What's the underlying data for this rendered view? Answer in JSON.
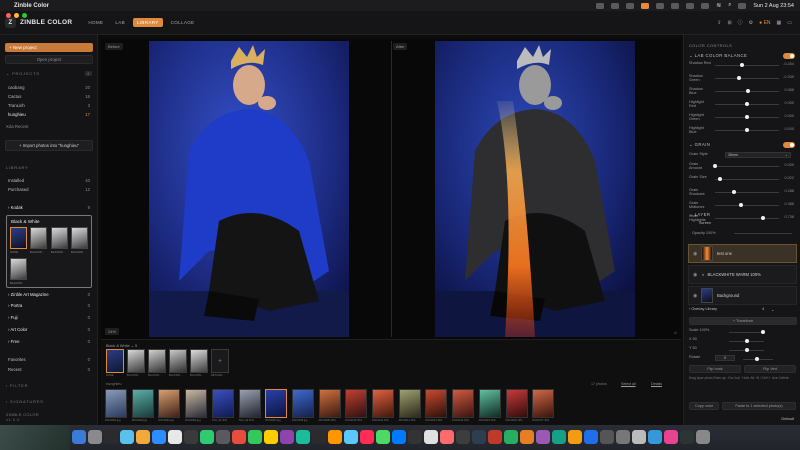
{
  "menubar": {
    "app_name": "Zinble Color",
    "datetime": "Sun 2 Aug  23:54"
  },
  "app": {
    "logo_letter": "Z",
    "title": "ZINBLE COLOR",
    "nav_tabs": [
      {
        "label": "HOME",
        "active": false
      },
      {
        "label": "LAB",
        "active": false
      },
      {
        "label": "LIBRARY",
        "active": true
      },
      {
        "label": "COLLAGE",
        "active": false
      }
    ],
    "user_label": "EN"
  },
  "left_sidebar": {
    "new_project_label": "+ New project",
    "open_project_label": "Open project",
    "projects_header": "PROJECTS",
    "projects_count": "4",
    "projects": [
      {
        "name": "caobang",
        "count": "20"
      },
      {
        "name": "Cactus",
        "count": "16"
      },
      {
        "name": "TranLinh",
        "count": "3"
      },
      {
        "name": "hunghieu",
        "count": "17"
      }
    ],
    "recent_label": "Xóa Recent",
    "import_label": "+ Import photos into \"hunghieu\"",
    "library_header": "LIBRARY",
    "library_items": [
      {
        "name": "Installed",
        "count": "40"
      },
      {
        "name": "Purchased",
        "count": "12"
      }
    ],
    "kodak": {
      "name": "Kodak",
      "count": "9"
    },
    "bw_group": {
      "name": "Black & White",
      "thumbs": [
        "NONE",
        "BLACKW...",
        "BLACKW...",
        "BLACKW...",
        "BLACKW..."
      ]
    },
    "collections": [
      {
        "name": "Zinble Art Magazine",
        "count": "0"
      },
      {
        "name": "Portra",
        "count": "0"
      },
      {
        "name": "Fuji",
        "count": "0"
      },
      {
        "name": "Art Color",
        "count": "0"
      },
      {
        "name": "Free",
        "count": "0"
      }
    ],
    "footer_items": [
      {
        "name": "Favorites",
        "count": "0"
      },
      {
        "name": "Recent",
        "count": "0"
      }
    ],
    "filter_header": "FILTER",
    "signature_header": "SIGNATURES",
    "brand": "ZINBLE COLOR",
    "version": "v1.0.0"
  },
  "canvas": {
    "before_label": "Before",
    "after_label": "After",
    "zoom": "24%"
  },
  "bottom": {
    "preset_group_label": "Black & White",
    "preset_count": "5",
    "preset_thumbs": [
      "NONE",
      "BLACKW...",
      "BLACKW...",
      "BLACKW...",
      "BLACKW...",
      "RETHINK..."
    ],
    "filmstrip_label": "hunghieu",
    "filmstrip_info": "17 photos",
    "select_all": "Select all",
    "details_label": "Details",
    "film_captions": [
      "DSC0001.jpg",
      "DSC0002.jpg",
      "DSC0003.jpg",
      "DSC0004.jpg",
      "THU_01.JPG",
      "THU_02.JPG",
      "DSC0007.jpg",
      "DSC0008.jpg",
      "DSC0009.JPG",
      "DSC0010.JPG",
      "DSC0011.JPG",
      "DSC0012.JPG",
      "DSC0013.JPG",
      "DSC0014.JPG",
      "DSC0015.JPG",
      "DSC0016.JPG",
      "DSC0017.JPG"
    ]
  },
  "right_panel": {
    "color_controls_header": "COLOR CONTROLS",
    "lab_balance_header": "LAB COLOR BALANCE",
    "lab_sliders": [
      {
        "label": "Shadow Red",
        "value": "-0.254",
        "pos": 0.42
      },
      {
        "label": "Shadow Green",
        "value": "-0.335",
        "pos": 0.38
      },
      {
        "label": "Shadow Blue",
        "value": "0.066",
        "pos": 0.52
      },
      {
        "label": "Highlight Red",
        "value": "0.000",
        "pos": 0.5
      },
      {
        "label": "Highlight Green",
        "value": "0.000",
        "pos": 0.5
      },
      {
        "label": "Highlight Blue",
        "value": "0.000",
        "pos": 0.5
      }
    ],
    "grain_header": "GRAIN",
    "grain_style_label": "Grain Style",
    "grain_style_value": "35mm",
    "grain_sliders": [
      {
        "label": "Grain Amount",
        "value": "0.000",
        "pos": 0.0
      },
      {
        "label": "Grain Size",
        "value": "0.022",
        "pos": 0.08
      },
      {
        "label": "Grain Shadows",
        "value": "0.288",
        "pos": 0.3
      },
      {
        "label": "Grain Midtones",
        "value": "0.386",
        "pos": 0.4
      },
      {
        "label": "Grain Highlights",
        "value": "0.738",
        "pos": 0.75
      }
    ],
    "layer_header": "LAYER",
    "blend_mode": "Screen",
    "opacity_label": "Opacity 100%",
    "layers": [
      {
        "name": "test one",
        "selected": true
      },
      {
        "name": "BLACKWHITE WARM  100%",
        "selected": false
      },
      {
        "name": "Background",
        "selected": false
      }
    ],
    "overlay_label": "Overlay Library",
    "overlay_count": "4",
    "transform_label": "+ Transform",
    "transform_rows": [
      {
        "label": "Scale 100%"
      },
      {
        "label": "X 50"
      },
      {
        "label": "Y 50"
      }
    ],
    "rotate_label": "Rotate",
    "rotate_value": "0",
    "flip_h": "Flip horiz",
    "flip_v": "Flip Vert",
    "hint_text": "Drag layer photo Enter ap · Esc Ival · Hold: Alt· W / Ctrl+I · Ave: Delete",
    "copy_label": "Copy color",
    "paste_label": "Paste to 1 selected photo(s)",
    "default_label": "Default"
  },
  "colors": {
    "accent": "#e08a3c",
    "background": "#0c0c0d",
    "panel": "#151517"
  }
}
